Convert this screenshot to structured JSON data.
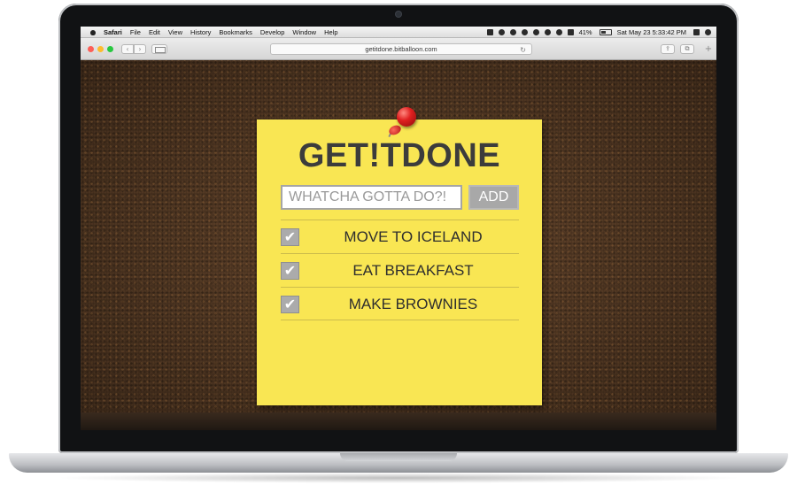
{
  "menubar": {
    "apple": "",
    "app_name": "Safari",
    "items": [
      "File",
      "Edit",
      "View",
      "History",
      "Bookmarks",
      "Develop",
      "Window",
      "Help"
    ],
    "battery_percent": "41%",
    "datetime": "Sat May 23  5:33:42 PM"
  },
  "browser": {
    "url": "getitdone.bitballoon.com",
    "back_label": "‹",
    "forward_label": "›",
    "reload_label": "↻",
    "share_label": "⇪",
    "tabs_label": "⧉",
    "newtab_label": "+"
  },
  "app": {
    "title": "GET!TDONE",
    "input_placeholder": "WHATCHA GOTTA DO?!",
    "add_label": "ADD",
    "check_glyph": "✔",
    "tasks": [
      {
        "label": "MOVE TO ICELAND",
        "done": true
      },
      {
        "label": "EAT BREAKFAST",
        "done": true
      },
      {
        "label": "MAKE BROWNIES",
        "done": true
      }
    ]
  },
  "colors": {
    "note": "#f9e653",
    "cork": "#5a3d26",
    "pin": "#e02020",
    "checkbox": "#ababab",
    "add_button": "#a8a8a8"
  }
}
